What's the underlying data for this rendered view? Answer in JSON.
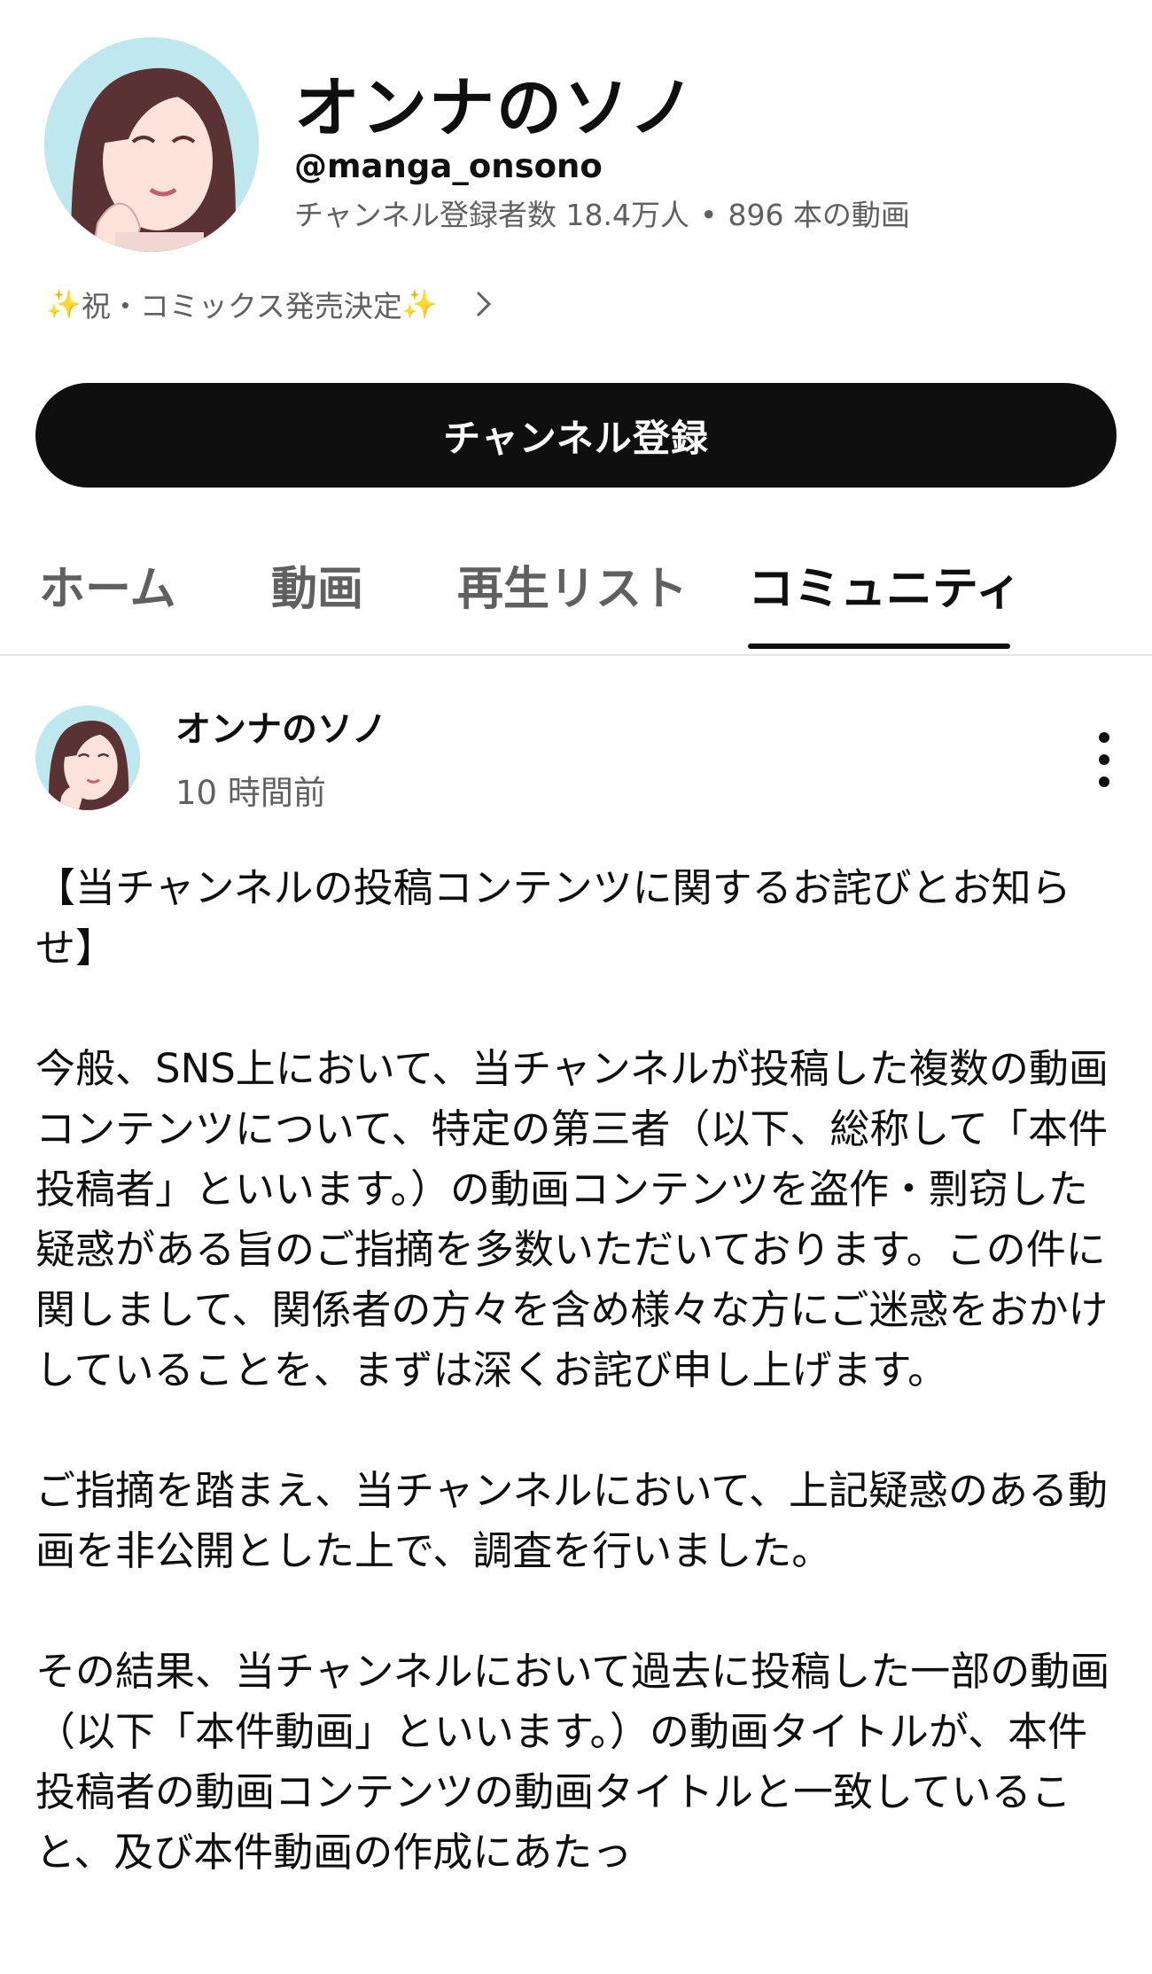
{
  "channel": {
    "name": "オンナのソノ",
    "handle": "@manga_onsono",
    "subscribers": "チャンネル登録者数 18.4万人",
    "separator": "•",
    "videos": "896 本の動画",
    "description_link": "祝・コミックス発売決定",
    "subscribe_label": "チャンネル登録"
  },
  "tabs": [
    {
      "label": "ホーム"
    },
    {
      "label": "動画"
    },
    {
      "label": "再生リスト"
    },
    {
      "label": "コミュニティ",
      "active": true
    }
  ],
  "post": {
    "author": "オンナのソノ",
    "time": "10 時間前",
    "paragraphs": [
      "【当チャンネルの投稿コンテンツに関するお詫びとお知らせ】",
      "今般、SNS上において、当チャンネルが投稿した複数の動画コンテンツについて、特定の第三者（以下、総称して「本件投稿者」といいます。）の動画コンテンツを盗作・剽窃した疑惑がある旨のご指摘を多数いただいております。この件に関しまして、関係者の方々を含め様々な方にご迷惑をおかけしていることを、まずは深くお詫び申し上げます。",
      "ご指摘を踏まえ、当チャンネルにおいて、上記疑惑のある動画を非公開とした上で、調査を行いました。",
      "その結果、当チャンネルにおいて過去に投稿した一部の動画（以下「本件動画」といいます。）の動画タイトルが、本件投稿者の動画コンテンツの動画タイトルと一致していること、及び本件動画の作成にあたっ"
    ]
  },
  "icons": {
    "sparkle": "sparkle-icon",
    "chevron": "chevron-right-icon",
    "more": "more-vert-icon"
  },
  "colors": {
    "primary_text": "#0f0f0f",
    "secondary_text": "#606060",
    "button_bg": "#0f0f0f",
    "sparkle": "#f2b705"
  }
}
